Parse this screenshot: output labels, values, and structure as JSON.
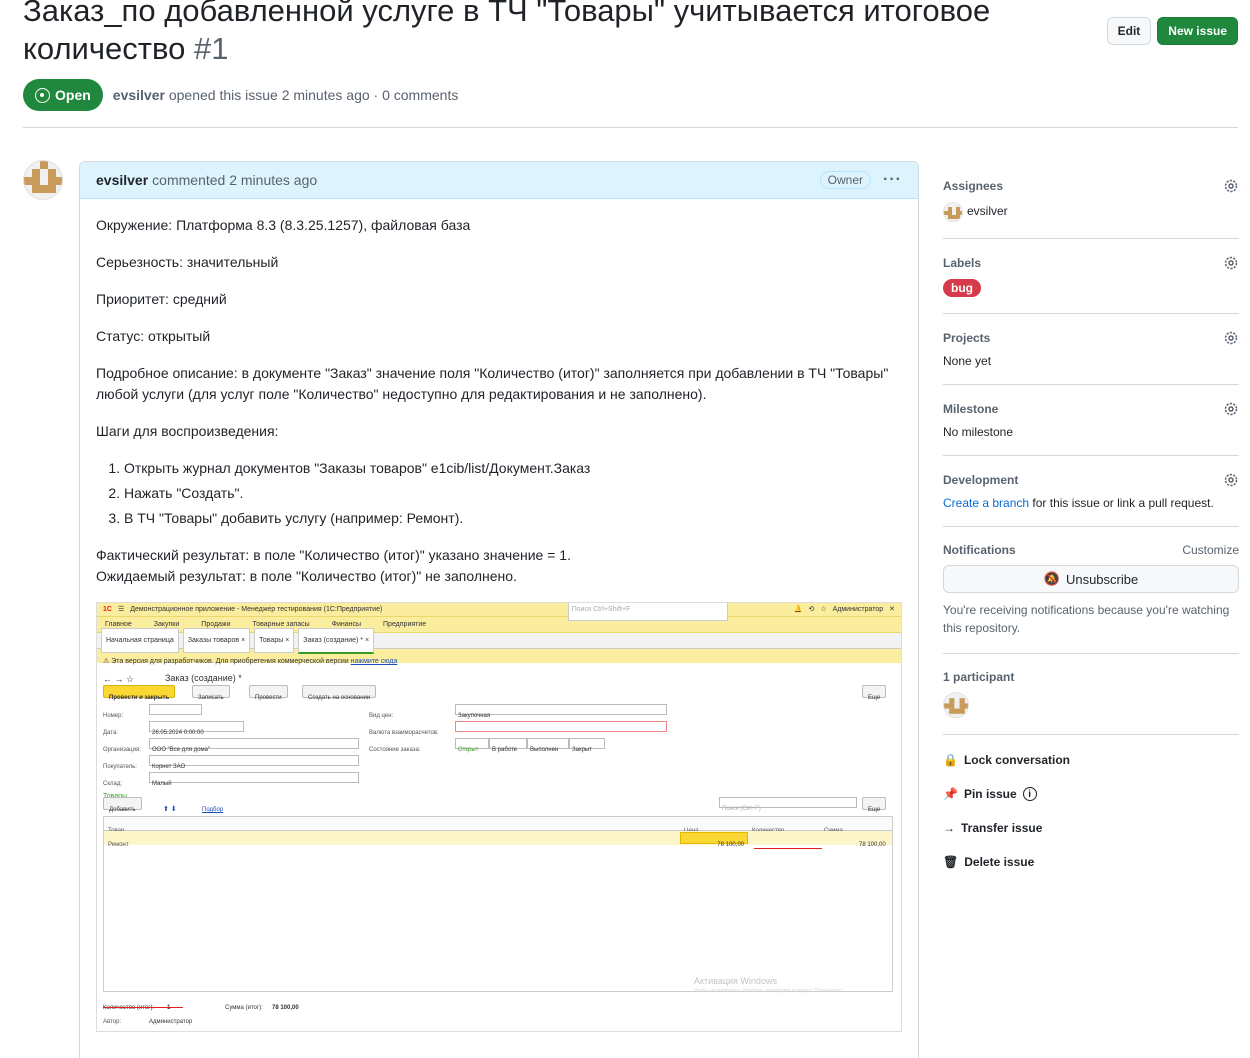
{
  "header": {
    "title": "Заказ_по добавленной услуге в ТЧ \"Товары\" учитывается итоговое количество",
    "number": "#1",
    "edit_label": "Edit",
    "new_issue_label": "New issue",
    "state": "Open",
    "author": "evsilver",
    "meta": "opened this issue 2 minutes ago · 0 comments"
  },
  "comment": {
    "author": "evsilver",
    "meta": "commented 2 minutes ago",
    "owner_badge": "Owner",
    "menu": "···",
    "p1": "Окружение: Платформа 8.3 (8.3.25.1257), файловая база",
    "p2": "Серьезность: значительный",
    "p3": "Приоритет: средний",
    "p4": "Статус: открытый",
    "p5": "Подробное описание: в документе \"Заказ\" значение поля \"Количество (итог)\" заполняется при добавлении в ТЧ \"Товары\" любой услуги (для услуг поле \"Количество\" недоступно для редактирования и не заполнено).",
    "p6": "Шаги для воспроизведения:",
    "steps": [
      "Открыть журнал документов \"Заказы товаров\" e1cib/list/Документ.Заказ",
      "Нажать \"Создать\".",
      "В ТЧ \"Товары\" добавить услугу (например: Ремонт)."
    ],
    "actual": "Фактический результат: в поле \"Количество (итог)\" указано значение = 1.",
    "expected": "Ожидаемый результат: в поле \"Количество (итог)\" не заполнено."
  },
  "screenshot": {
    "app_title": "Демонстрационное приложение - Менеджер тестирования (1С:Предприятие)",
    "search": "Поиск Ctrl+Shift+F",
    "user": "Администратор",
    "menu": [
      "Главное",
      "Закупки",
      "Продажи",
      "Товарные запасы",
      "Финансы",
      "Предприятие"
    ],
    "tabs": [
      "Начальная страница",
      "Заказы товаров ×",
      "Товары ×",
      "Заказ (создание) * ×"
    ],
    "warning": "Эта версия для разработчиков. Для приобретения коммерческой версии",
    "warning_link": "нажмите сюда",
    "form_title": "Заказ (создание) *",
    "btn_post_close": "Провести и закрыть",
    "btn_save": "Записать",
    "btn_post": "Провести",
    "btn_create_based": "Создать на основании",
    "btn_more": "Еще",
    "lbl_number": "Номер:",
    "lbl_date": "Дата:",
    "date": "26.05.2024  0:00:00",
    "lbl_org": "Организация:",
    "org": "ООО \"Все для дома\"",
    "lbl_buyer": "Покупатель:",
    "buyer": "Корнет ЗАО",
    "lbl_store": "Склад:",
    "store": "Малый",
    "lbl_price_type": "Вид цен:",
    "price_type": "Закупочная",
    "lbl_currency": "Валюта взаиморасчетов:",
    "lbl_state": "Состояние заказа:",
    "states": [
      "Открыт",
      "В работе",
      "Выполнен",
      "Закрыт"
    ],
    "goods": "Товары",
    "btn_add": "Добавить",
    "pick": "Подбор",
    "grid_search": "Поиск (Ctrl+F)",
    "col_goods": "Товар",
    "col_price": "Цена",
    "col_qty": "Количество",
    "col_sum": "Сумма",
    "row_goods": "Ремонт",
    "row_price": "78 100,00",
    "row_sum": "78 100,00",
    "total_qty_lbl": "Количество (итог):",
    "total_qty": "1",
    "total_sum_lbl": "Сумма (итог):",
    "total_sum": "78 100,00",
    "author_lbl": "Автор:",
    "author": "Администратор",
    "activation": "Активация Windows",
    "activation_sub": "Чтобы активировать Windows, перейдите в раздел \"Параметры\"."
  },
  "sidebar": {
    "assignees_label": "Assignees",
    "assignee": "evsilver",
    "labels_label": "Labels",
    "label_bug": "bug",
    "projects_label": "Projects",
    "projects_val": "None yet",
    "milestone_label": "Milestone",
    "milestone_val": "No milestone",
    "development_label": "Development",
    "dev_link": "Create a branch",
    "dev_text": "for this issue or link a pull request.",
    "notifications_label": "Notifications",
    "customize": "Customize",
    "unsubscribe": "Unsubscribe",
    "notif_text": "You're receiving notifications because you're watching this repository.",
    "participants": "1 participant",
    "lock": "Lock conversation",
    "pin": "Pin issue",
    "transfer": "Transfer issue",
    "delete": "Delete issue"
  }
}
